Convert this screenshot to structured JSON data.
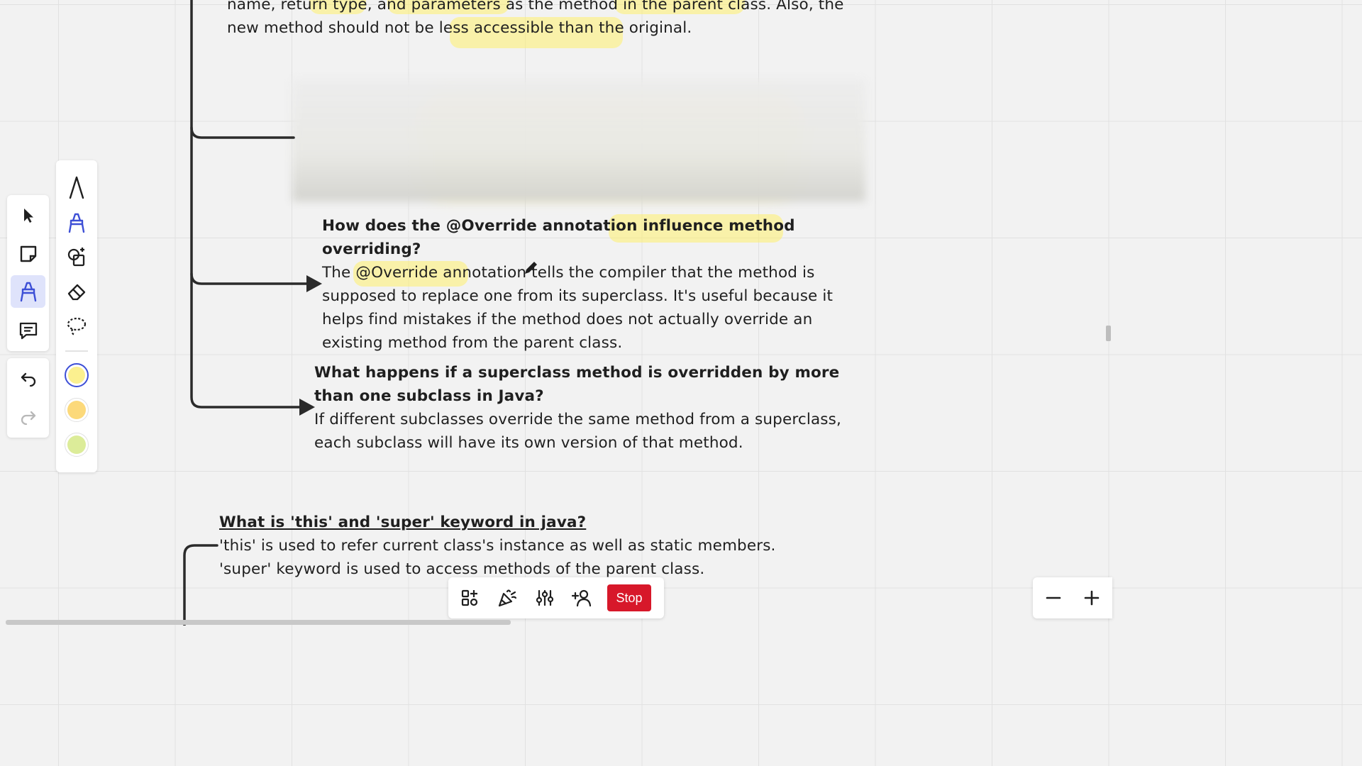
{
  "canvas": {
    "top_text": {
      "line1": "name, return type, and parameters as the method in the parent class.  Also, the",
      "line2": "new method should not be less accessible than the original."
    },
    "q1": {
      "question_line1": "How does the @Override annotation influence method",
      "question_line2": "overriding?",
      "answer_lines": [
        "The @Override annotation tells the compiler that the method is",
        "supposed to replace one from its superclass. It's useful because it",
        "helps find mistakes if the method does not actually override an",
        "existing  method from the parent class."
      ]
    },
    "q2": {
      "question_line1": "What happens if a superclass method is overridden by more",
      "question_line2": "than one subclass in Java?",
      "answer_lines": [
        "If different subclasses override the same method from a superclass,",
        "each subclass will have its own version of that method."
      ]
    },
    "q3": {
      "question": "What is 'this' and 'super' keyword in java?",
      "answer_lines": [
        " 'this' is used to refer current class's instance as well as static members.",
        "'super' keyword is used to access methods of the parent class."
      ]
    }
  },
  "left_toolbar": {
    "tools": [
      "select-icon",
      "sticky-note-icon",
      "pen-icon",
      "comment-icon"
    ],
    "active_tool": "pen-icon",
    "history": [
      "undo-icon",
      "redo-icon"
    ]
  },
  "pen_panel": {
    "tools": [
      "pen-icon",
      "highlighter-icon",
      "smart-shape-icon",
      "eraser-icon",
      "lasso-icon"
    ],
    "colors": [
      "#fbf08f",
      "#fcd97a",
      "#dcec99"
    ],
    "selected_color": "#fbf08f"
  },
  "bottom_toolbar": {
    "icons": [
      "apps-icon",
      "celebrate-icon",
      "settings-sliders-icon",
      "invite-user-icon"
    ],
    "stop_label": "Stop",
    "stop_color": "#d7182a"
  },
  "zoom": {
    "out_label": "−",
    "in_label": "+"
  }
}
